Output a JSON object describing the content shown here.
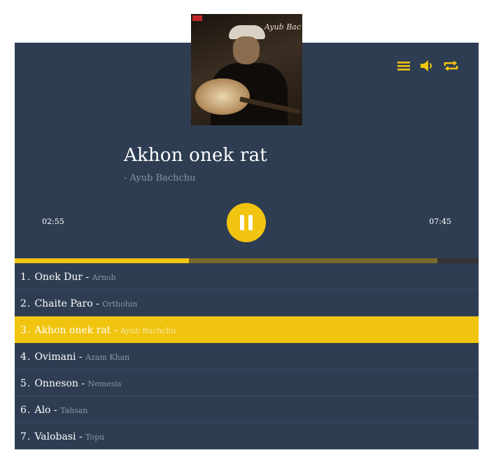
{
  "cover": {
    "signature": "Ayub Bac",
    "alt": "album-cover-guitarist"
  },
  "controls": {
    "playlist_icon": "menu-icon",
    "volume_icon": "volume-icon",
    "repeat_icon": "repeat-icon"
  },
  "now_playing": {
    "title": "Akhon onek rat",
    "artist": "- Ayub Bachchu",
    "current_time": "02:55",
    "total_time": "07:45",
    "played_fraction": 0.376,
    "buffered_fraction": 0.911
  },
  "colors": {
    "accent": "#f1c40f",
    "panel": "#2e3d52",
    "muted_text": "#8a96a6"
  },
  "playlist": [
    {
      "num": "1.",
      "name": "Onek Dur",
      "sep": " - ",
      "artist": "Arnob",
      "active": false
    },
    {
      "num": "2.",
      "name": "Chaite Paro",
      "sep": " - ",
      "artist": "Orthohin",
      "active": false
    },
    {
      "num": "3.",
      "name": "Akhon onek rat",
      "sep": " - ",
      "artist": "Ayub Bachchu",
      "active": true
    },
    {
      "num": "4.",
      "name": "Ovimani",
      "sep": " - ",
      "artist": "Azam Khan",
      "active": false
    },
    {
      "num": "5.",
      "name": "Onneson",
      "sep": " - ",
      "artist": "Nemesis",
      "active": false
    },
    {
      "num": "6.",
      "name": "Alo",
      "sep": " - ",
      "artist": "Tahsan",
      "active": false
    },
    {
      "num": "7.",
      "name": "Valobasi",
      "sep": " - ",
      "artist": "Topu",
      "active": false
    }
  ]
}
